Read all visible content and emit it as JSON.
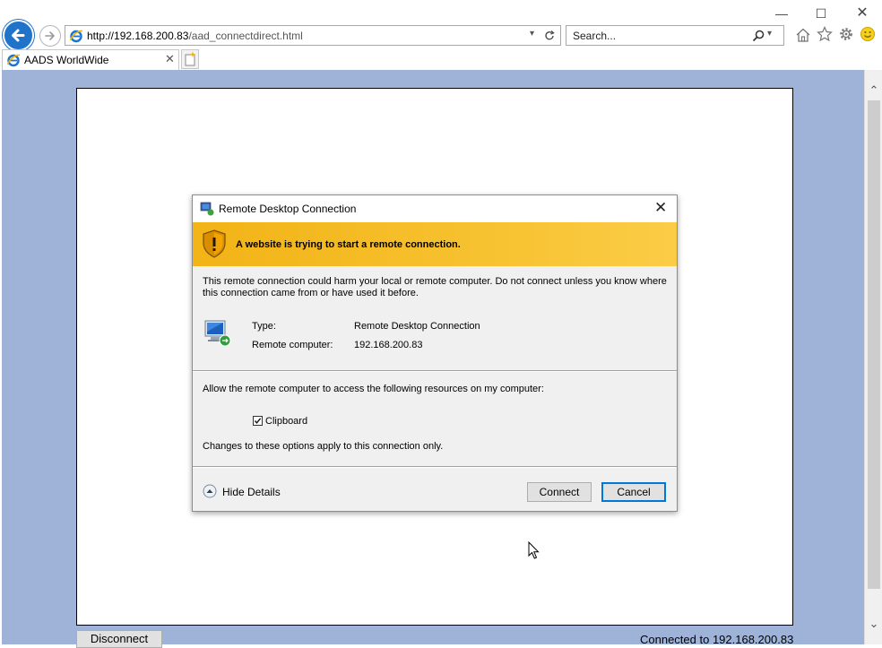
{
  "browser": {
    "address": {
      "host": "http://192.168.200.83",
      "path": "/aad_connectdirect.html"
    },
    "search": {
      "placeholder": "Search..."
    },
    "tab": {
      "title": "AADS WorldWide"
    },
    "icons": [
      "back-arrow-icon",
      "forward-arrow-icon",
      "ie-logo-icon",
      "dropdown-icon",
      "refresh-icon",
      "search-icon",
      "home-icon",
      "favorites-star-icon",
      "settings-gear-icon",
      "smiley-feedback-icon",
      "minimize-icon",
      "maximize-icon",
      "close-icon"
    ]
  },
  "page": {
    "disconnect_label": "Disconnect",
    "status_text": "Connected to 192.168.200.83",
    "background_color": "#9fb3d9"
  },
  "dialog": {
    "title": "Remote Desktop Connection",
    "warning": "A website is trying to start a remote connection.",
    "message": "This remote connection could harm your local or remote computer. Do not connect unless you know where this connection came from or have used it before.",
    "type_label": "Type:",
    "type_value": "Remote Desktop Connection",
    "remote_label": "Remote computer:",
    "remote_value": "192.168.200.83",
    "resources_text": "Allow the remote computer to access the following resources on my computer:",
    "clipboard_label": "Clipboard",
    "clipboard_checked": true,
    "changes_note": "Changes to these options apply to this connection only.",
    "hide_details_label": "Hide Details",
    "connect_label": "Connect",
    "cancel_label": "Cancel",
    "warning_color": "#f2b316",
    "primary_button_color": "#0078d7"
  }
}
